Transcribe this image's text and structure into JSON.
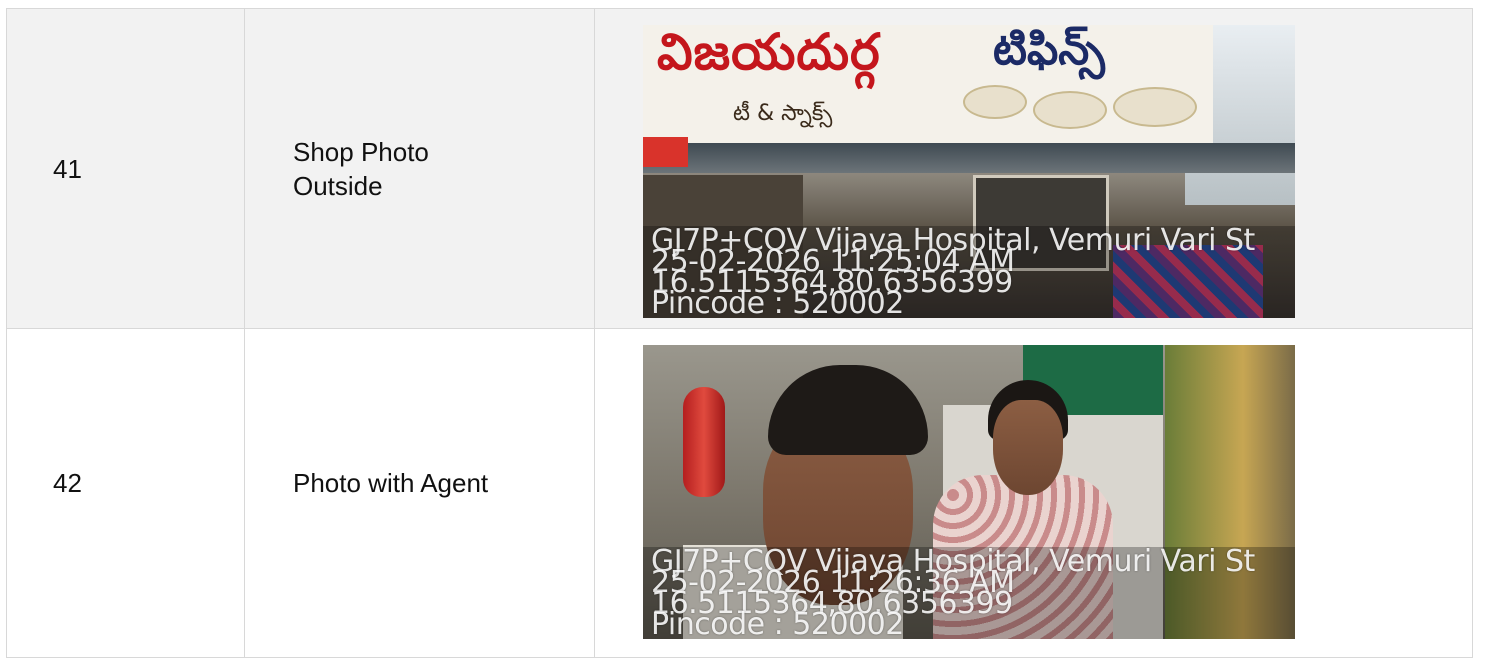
{
  "rows": [
    {
      "number": "41",
      "label": "Shop Photo Outside",
      "photo": {
        "board_title": "విజయదుర్గ",
        "board_title2": "టిఫిన్స్",
        "board_sub": "టీ & స్నాక్స్",
        "stamp_lines": [
          "GJ7P+CQV Vijaya Hospital, Vemuri Vari St",
          "25-02-2026 11:25:04 AM",
          "16.5115364,80.6356399",
          "Pincode : 520002"
        ]
      }
    },
    {
      "number": "42",
      "label": "Photo with Agent",
      "photo": {
        "stamp_lines": [
          "GJ7P+CQV Vijaya Hospital, Vemuri Vari St",
          "25-02-2026 11:26:36 AM",
          "16.5115364,80.6356399",
          "Pincode : 520002"
        ]
      }
    }
  ]
}
